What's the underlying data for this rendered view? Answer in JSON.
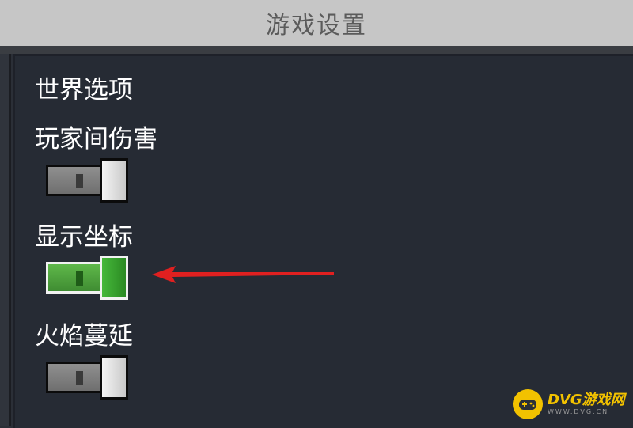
{
  "header": {
    "title": "游戏设置"
  },
  "section": {
    "title": "世界选项"
  },
  "options": [
    {
      "label": "玩家间伤害",
      "enabled": false
    },
    {
      "label": "显示坐标",
      "enabled": true
    },
    {
      "label": "火焰蔓延",
      "enabled": false
    }
  ],
  "colors": {
    "header_bg": "#c6c6c6",
    "panel_bg": "#262b34",
    "toggle_on": "#3f9b35",
    "toggle_off": "#7d7d7d",
    "arrow": "#e02020",
    "watermark": "#f2c200"
  },
  "watermark": {
    "text": "DVG游戏网",
    "url": "WWW.DVG.CN",
    "icon": "gamepad-icon"
  }
}
